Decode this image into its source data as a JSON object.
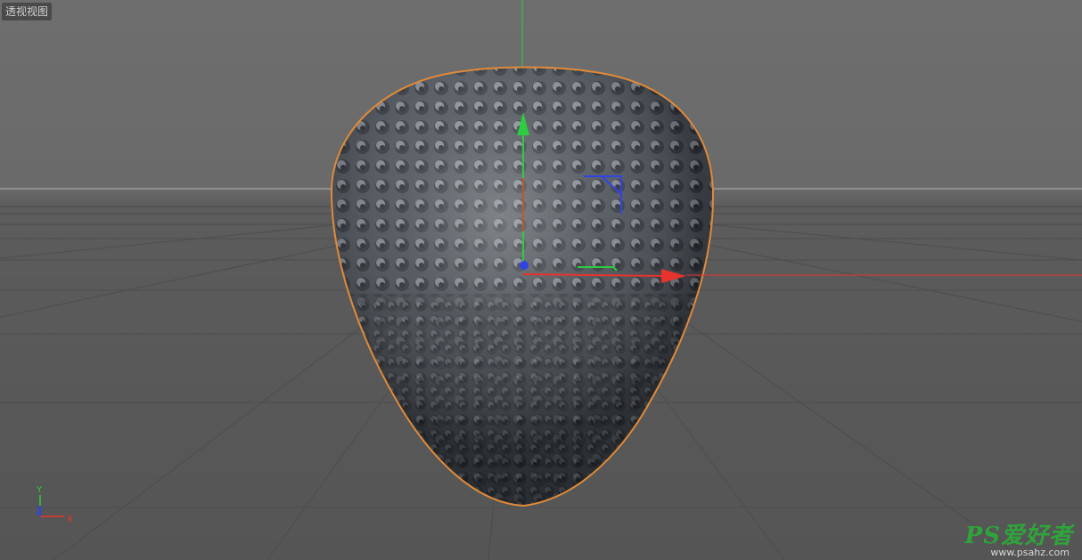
{
  "viewport": {
    "label": "透视视图"
  },
  "colors": {
    "axis_x": "#e8322e",
    "axis_y": "#2ecc40",
    "axis_z": "#3044e6",
    "selection_outline": "#e08a3a",
    "object_surface": "#4a5058"
  },
  "mini_axis": {
    "y_label": "Y",
    "z_label": "Z",
    "x_label": "X"
  },
  "watermark": {
    "logo_text": "PS爱好者",
    "url_text": "www.psahz.com"
  }
}
